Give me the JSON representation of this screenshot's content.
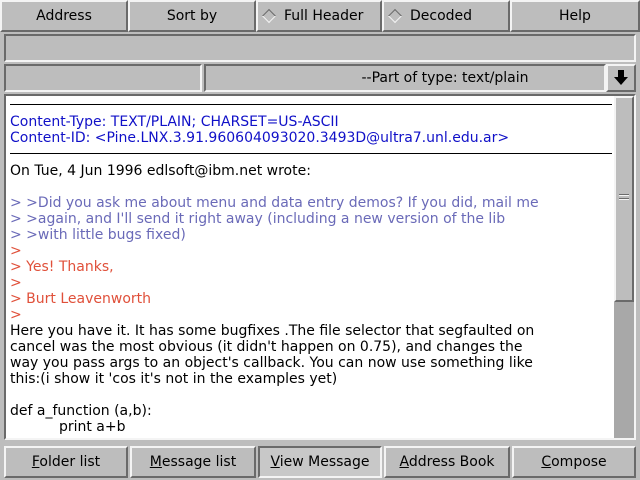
{
  "toolbar": {
    "address": "Address",
    "sort_by": "Sort by",
    "full_header": "Full Header",
    "decoded": "Decoded",
    "help": "Help"
  },
  "part_selector": {
    "label": "--Part of type: text/plain",
    "menu_icon": "arrow-down-icon"
  },
  "message": {
    "header_lines": [
      "Content-Type: TEXT/PLAIN; CHARSET=US-ASCII",
      "Content-ID: <Pine.LNX.3.91.960604093020.3493D@ultra7.unl.edu.ar>"
    ],
    "attribution": "On Tue, 4 Jun 1996 edlsoft@ibm.net wrote:",
    "quoted_nested": [
      "> >Did you ask me about menu and data entry demos? If you did, mail me",
      "> >again, and I'll send it right away (including a new version of the lib",
      "> >with little bugs fixed)"
    ],
    "quoted": [
      ">",
      "> Yes! Thanks,",
      ">",
      "> Burt Leavenworth",
      ">"
    ],
    "body": [
      "Here you have it. It has some bugfixes .The file selector that segfaulted on",
      "cancel was the most obvious (it didn't happen on 0.75), and changes the",
      "way you pass args to an object's callback. You can now use something like",
      "this:(i show it 'cos it's not in the examples yet)",
      "",
      "def a_function (a,b):",
      "           print a+b"
    ]
  },
  "bottom_bar": {
    "folder_list": [
      "F",
      "older list"
    ],
    "message_list": [
      "M",
      "essage list"
    ],
    "view_message": [
      "V",
      "iew Message"
    ],
    "address_book": [
      "A",
      "ddress Book"
    ],
    "compose": [
      "C",
      "ompose"
    ]
  },
  "colors": {
    "background": "#bdbdbd",
    "header_text": "#1010c8",
    "quote_level2": "#6a6ab8",
    "quote_level1": "#e0503a"
  }
}
